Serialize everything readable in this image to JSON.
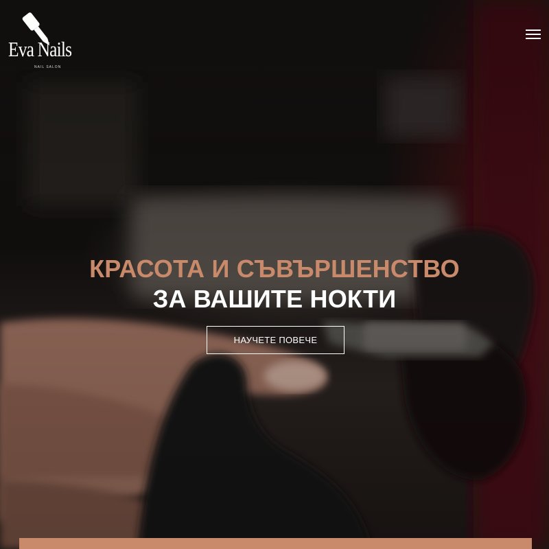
{
  "logo": {
    "wordmark": "Eva Nails",
    "tagline": "NAIL SALON",
    "icon": "nail-polish-brush-icon"
  },
  "nav": {
    "menu_icon": "hamburger-menu-icon"
  },
  "hero": {
    "headline_accent": "КРАСОТА И СЪВЪРШЕНСТВО",
    "headline_main": "ЗА ВАШИТЕ НОКТИ",
    "cta_label": "НАУЧЕТЕ ПОВЕЧЕ",
    "background_image": "manicure-with-nail-drill-photo"
  },
  "colors": {
    "accent": "#c98a6b",
    "text": "#ffffff"
  }
}
